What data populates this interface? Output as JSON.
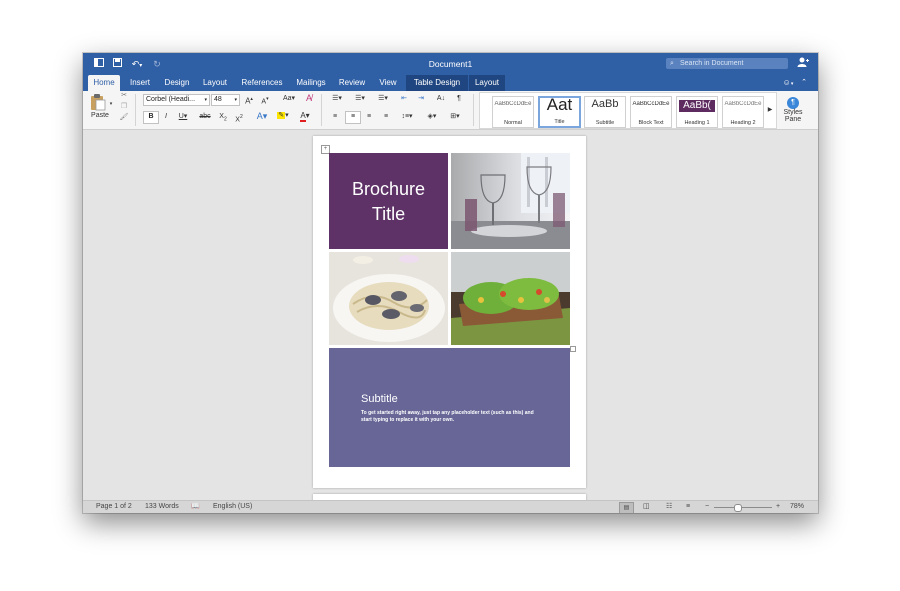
{
  "window": {
    "title": "Document1",
    "search_placeholder": "Search in Document"
  },
  "tabs": [
    {
      "label": "Home",
      "active": true
    },
    {
      "label": "Insert"
    },
    {
      "label": "Design"
    },
    {
      "label": "Layout"
    },
    {
      "label": "References"
    },
    {
      "label": "Mailings"
    },
    {
      "label": "Review"
    },
    {
      "label": "View"
    },
    {
      "label": "Table Design",
      "contextual": true
    },
    {
      "label": "Layout",
      "contextual": true
    }
  ],
  "ribbon": {
    "paste_label": "Paste",
    "font_name": "Corbel (Headi...",
    "font_size": "48",
    "styles": [
      {
        "preview": "AaBbCcDdEe",
        "name": "Normal"
      },
      {
        "preview": "Aat",
        "name": "Title",
        "selected": true
      },
      {
        "preview": "AaBb",
        "name": "Subtitle"
      },
      {
        "preview": "AaBbCcDdEe",
        "name": "Block Text"
      },
      {
        "preview": "AaBb(",
        "name": "Heading 1"
      },
      {
        "preview": "AaBbCcDdEe",
        "name": "Heading 2"
      }
    ],
    "styles_pane_line1": "Styles",
    "styles_pane_line2": "Pane"
  },
  "document": {
    "title_line1": "Brochure",
    "title_line2": "Title",
    "subtitle": "Subtitle",
    "body_line1": "To get started right away, just tap any placeholder text (such as this) and",
    "body_line2": "start typing to replace it with your own."
  },
  "status": {
    "page": "Page 1 of 2",
    "words": "133 Words",
    "language": "English (US)",
    "zoom": "78%"
  },
  "colors": {
    "titlebar": "#2f5fa5",
    "title_block": "#5e3267",
    "subtitle_block": "#676697",
    "style_heading1": "#5e2b61"
  }
}
